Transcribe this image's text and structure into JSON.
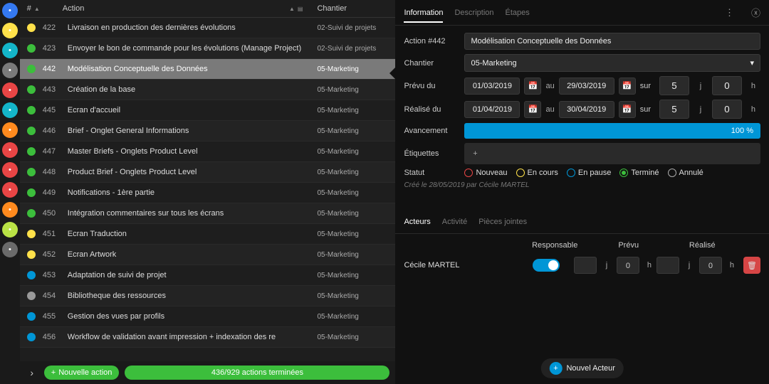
{
  "iconbar": [
    "#3478f0",
    "#ffe14a",
    "#14b5c9",
    "#7a7a7a",
    "#e84545",
    "#14b5c9",
    "#ff8a1e",
    "#e84545",
    "#e84545",
    "#e84545",
    "#ff8a1e",
    "#b9e245",
    "#6a6a6a"
  ],
  "headers": {
    "num": "#",
    "action": "Action",
    "chantier": "Chantier"
  },
  "rows": [
    {
      "c": "#ffe14a",
      "n": "422",
      "a": "Livraison en production des dernières évolutions",
      "ch": "02-Suivi de projets"
    },
    {
      "c": "#3cbe3c",
      "n": "423",
      "a": "Envoyer le bon de commande pour les évolutions (Manage Project)",
      "ch": "02-Suivi de projets"
    },
    {
      "c": "#3cbe3c",
      "n": "442",
      "a": "Modélisation Conceptuelle des Données",
      "ch": "05-Marketing",
      "sel": true
    },
    {
      "c": "#3cbe3c",
      "n": "443",
      "a": "Création de la base",
      "ch": "05-Marketing"
    },
    {
      "c": "#3cbe3c",
      "n": "445",
      "a": "Ecran d'accueil",
      "ch": "05-Marketing"
    },
    {
      "c": "#3cbe3c",
      "n": "446",
      "a": "Brief - Onglet General Informations",
      "ch": "05-Marketing"
    },
    {
      "c": "#3cbe3c",
      "n": "447",
      "a": "Master Briefs - Onglets Product Level",
      "ch": "05-Marketing"
    },
    {
      "c": "#3cbe3c",
      "n": "448",
      "a": "Product Brief - Onglets Product Level",
      "ch": "05-Marketing"
    },
    {
      "c": "#3cbe3c",
      "n": "449",
      "a": "Notifications - 1ère partie",
      "ch": "05-Marketing"
    },
    {
      "c": "#3cbe3c",
      "n": "450",
      "a": "Intégration commentaires sur tous les écrans",
      "ch": "05-Marketing"
    },
    {
      "c": "#ffe14a",
      "n": "451",
      "a": "Ecran Traduction",
      "ch": "05-Marketing"
    },
    {
      "c": "#ffe14a",
      "n": "452",
      "a": "Ecran Artwork",
      "ch": "05-Marketing"
    },
    {
      "c": "#0096d6",
      "n": "453",
      "a": "Adaptation de suivi de projet",
      "ch": "05-Marketing"
    },
    {
      "c": "#9a9a9a",
      "n": "454",
      "a": "Bibliotheque des ressources",
      "ch": "05-Marketing"
    },
    {
      "c": "#0096d6",
      "n": "455",
      "a": "Gestion des vues par profils",
      "ch": "05-Marketing"
    },
    {
      "c": "#0096d6",
      "n": "456",
      "a": "Workflow de validation avant impression + indexation des re",
      "ch": "05-Marketing"
    }
  ],
  "footer": {
    "new": "Nouvelle action",
    "progress": "436/929 actions terminées"
  },
  "tabs": {
    "info": "Information",
    "desc": "Description",
    "etapes": "Étapes"
  },
  "form": {
    "actionId": "Action #442",
    "actionVal": "Modélisation Conceptuelle des Données",
    "chantier": "Chantier",
    "chantierVal": "05-Marketing",
    "prevu": "Prévu du",
    "prevuFrom": "01/03/2019",
    "au": "au",
    "prevuTo": "29/03/2019",
    "sur": "sur",
    "prevuJ": "5",
    "prevuH": "0",
    "realise": "Réalisé du",
    "realiseFrom": "01/04/2019",
    "realiseTo": "30/04/2019",
    "realiseJ": "5",
    "realiseH": "0",
    "avance": "Avancement",
    "avanceVal": "100 %",
    "etiq": "Étiquettes",
    "statut": "Statut",
    "statuses": [
      {
        "l": "Nouveau",
        "c": "#e84545"
      },
      {
        "l": "En cours",
        "c": "#ffe14a"
      },
      {
        "l": "En pause",
        "c": "#0096d6"
      },
      {
        "l": "Terminé",
        "c": "#3cbe3c",
        "on": true
      },
      {
        "l": "Annulé",
        "c": "#aaa"
      }
    ],
    "meta": "Créé le 28/05/2019 par Cécile MARTEL"
  },
  "subtabs": {
    "acteurs": "Acteurs",
    "activite": "Activité",
    "pj": "Pièces jointes"
  },
  "actors": {
    "resp": "Responsable",
    "prevu": "Prévu",
    "realise": "Réalisé",
    "name": "Cécile MARTEL",
    "prevuJ": "",
    "prevuJu": "j",
    "prevuH": "0",
    "prevuHu": "h",
    "realiseJ": "",
    "realiseJu": "j",
    "realiseH": "0",
    "realiseHu": "h",
    "new": "Nouvel Acteur"
  },
  "j": "j",
  "h": "h"
}
